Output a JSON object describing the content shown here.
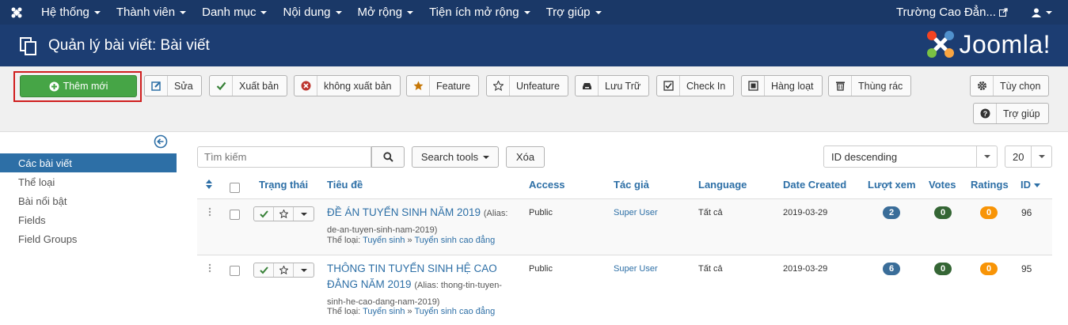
{
  "topnav": {
    "menu": [
      "Hệ thống",
      "Thành viên",
      "Danh mục",
      "Nội dung",
      "Mở rộng",
      "Tiện ích mở rộng",
      "Trợ giúp"
    ],
    "site_name": "Trường Cao Đẳn..."
  },
  "header": {
    "title": "Quản lý bài viết: Bài viết",
    "brand": "Joomla!"
  },
  "toolbar": {
    "new": "Thêm mới",
    "edit": "Sửa",
    "publish": "Xuất bản",
    "unpublish": "không xuất bản",
    "feature": "Feature",
    "unfeature": "Unfeature",
    "archive": "Lưu Trữ",
    "checkin": "Check In",
    "batch": "Hàng loạt",
    "trash": "Thùng rác",
    "options": "Tùy chọn",
    "help": "Trợ giúp"
  },
  "sidebar": {
    "items": [
      "Các bài viết",
      "Thể loại",
      "Bài nổi bật",
      "Fields",
      "Field Groups"
    ]
  },
  "filters": {
    "search_placeholder": "Tìm kiếm",
    "search_tools": "Search tools",
    "clear": "Xóa",
    "ordering": "ID descending",
    "limit": "20"
  },
  "table": {
    "columns": {
      "status": "Trạng thái",
      "title": "Tiêu đề",
      "access": "Access",
      "author": "Tác giả",
      "language": "Language",
      "date": "Date Created",
      "hits": "Lượt xem",
      "votes": "Votes",
      "ratings": "Ratings",
      "id": "ID"
    },
    "category_prefix": "Thể loại:",
    "rows": [
      {
        "title": "ĐỀ ÁN TUYỂN SINH NĂM 2019",
        "alias": "(Alias: de-an-tuyen-sinh-nam-2019)",
        "category": "Tuyển sinh",
        "subcategory": "Tuyển sinh cao đẳng",
        "access": "Public",
        "author": "Super User",
        "language": "Tất cả",
        "date": "2019-03-29",
        "hits": "2",
        "votes": "0",
        "ratings": "0",
        "id": "96"
      },
      {
        "title": "THÔNG TIN TUYỂN SINH HỆ CAO ĐẲNG NĂM 2019",
        "alias": "(Alias: thong-tin-tuyen-sinh-he-cao-dang-nam-2019)",
        "category": "Tuyển sinh",
        "subcategory": "Tuyển sinh cao đẳng",
        "access": "Public",
        "author": "Super User",
        "language": "Tất cả",
        "date": "2019-03-29",
        "hits": "6",
        "votes": "0",
        "ratings": "0",
        "id": "95"
      }
    ]
  },
  "colors": {
    "nav": "#1a3867",
    "header": "#1c3d72",
    "green": "#46a546",
    "link": "#2d6fa6",
    "hits_badge": "#3a6d99",
    "votes_badge": "#356635",
    "ratings_badge": "#f89406"
  }
}
